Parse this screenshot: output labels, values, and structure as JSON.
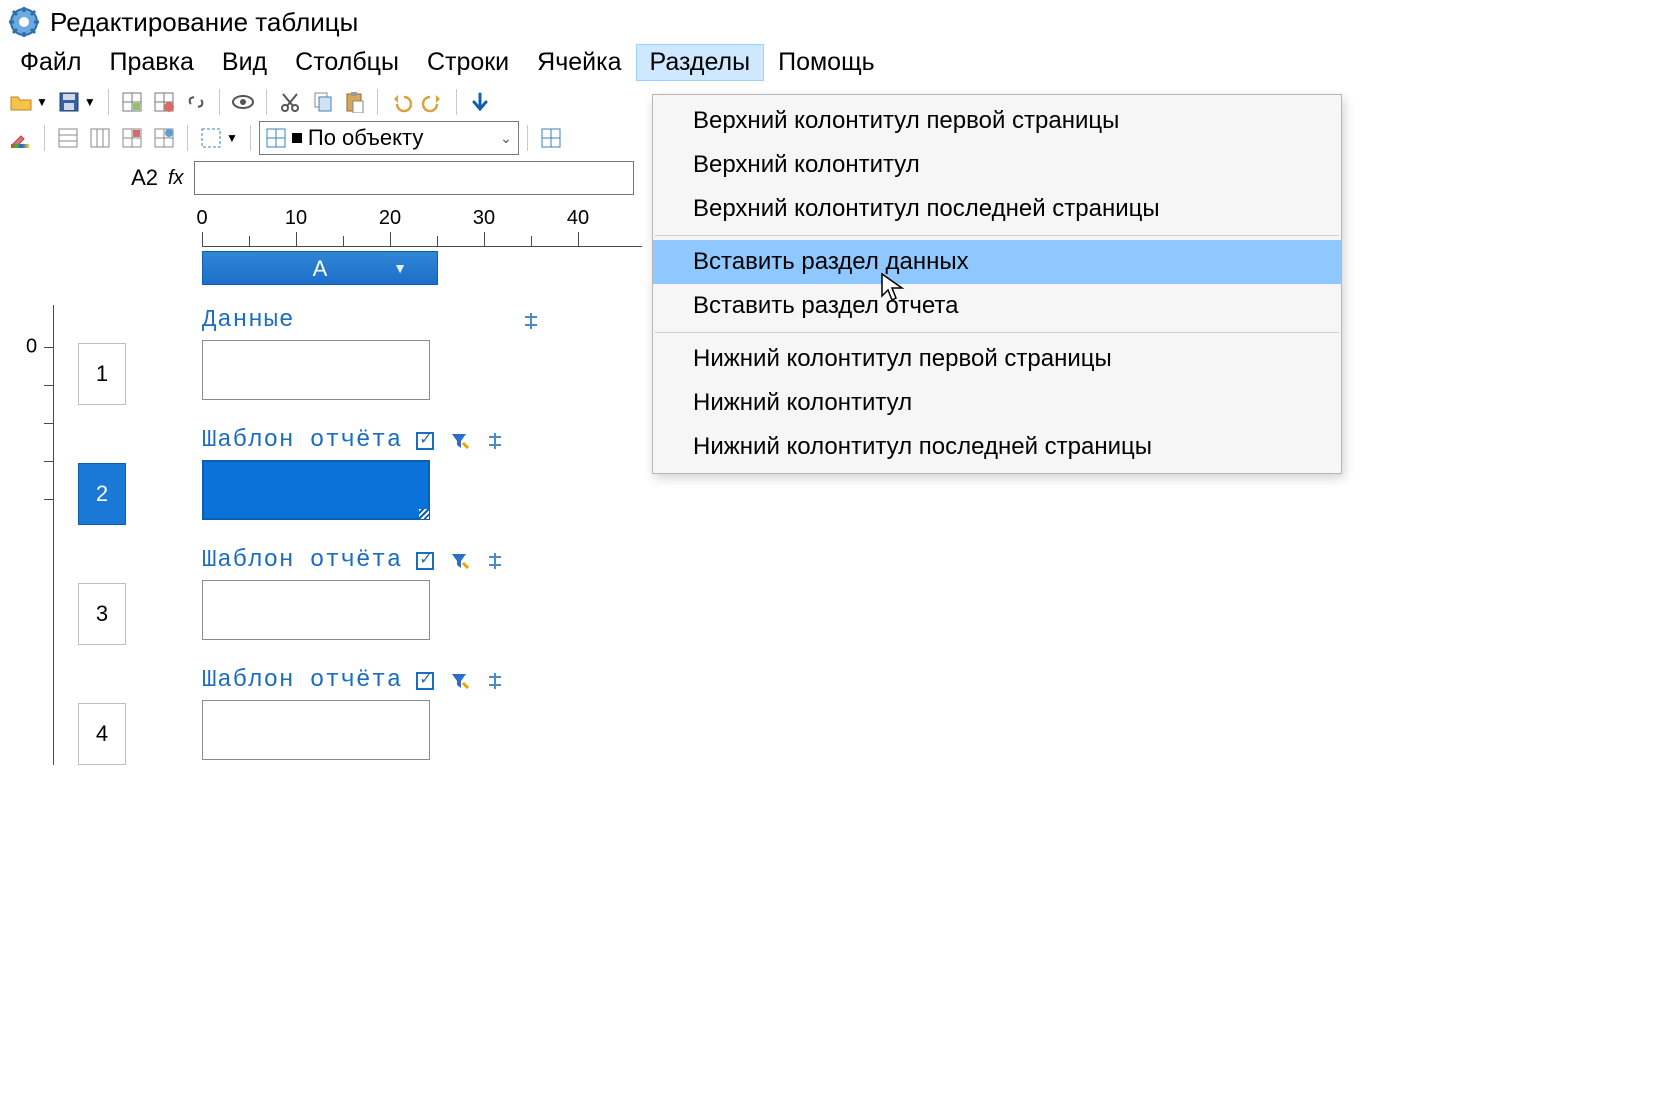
{
  "window": {
    "title": "Редактирование таблицы"
  },
  "menu": {
    "items": [
      "Файл",
      "Правка",
      "Вид",
      "Столбцы",
      "Строки",
      "Ячейка",
      "Разделы",
      "Помощь"
    ],
    "open_index": 6
  },
  "toolbar2": {
    "combo_value": "По объекту"
  },
  "formula": {
    "cell_ref": "A2",
    "fx_label": "fx",
    "value": ""
  },
  "ruler": {
    "labels": [
      "0",
      "10",
      "20",
      "30",
      "40"
    ]
  },
  "column_header": {
    "label": "A"
  },
  "vruler": {
    "labels": [
      "0"
    ]
  },
  "sections": [
    {
      "title": "Данные",
      "has_checkbox": false,
      "has_filter": false
    },
    {
      "title": "Шаблон отчёта",
      "has_checkbox": true,
      "has_filter": true
    },
    {
      "title": "Шаблон отчёта",
      "has_checkbox": true,
      "has_filter": true
    },
    {
      "title": "Шаблон отчёта",
      "has_checkbox": true,
      "has_filter": true
    }
  ],
  "rows": {
    "labels": [
      "1",
      "2",
      "3",
      "4"
    ],
    "selected_index": 1
  },
  "dropdown": {
    "groups": [
      [
        "Верхний колонтитул первой страницы",
        "Верхний колонтитул",
        "Верхний колонтитул последней страницы"
      ],
      [
        "Вставить раздел данных",
        "Вставить раздел отчета"
      ],
      [
        "Нижний колонтитул первой страницы",
        "Нижний колонтитул",
        "Нижний колонтитул последней страницы"
      ]
    ],
    "highlight": "Вставить раздел данных"
  }
}
